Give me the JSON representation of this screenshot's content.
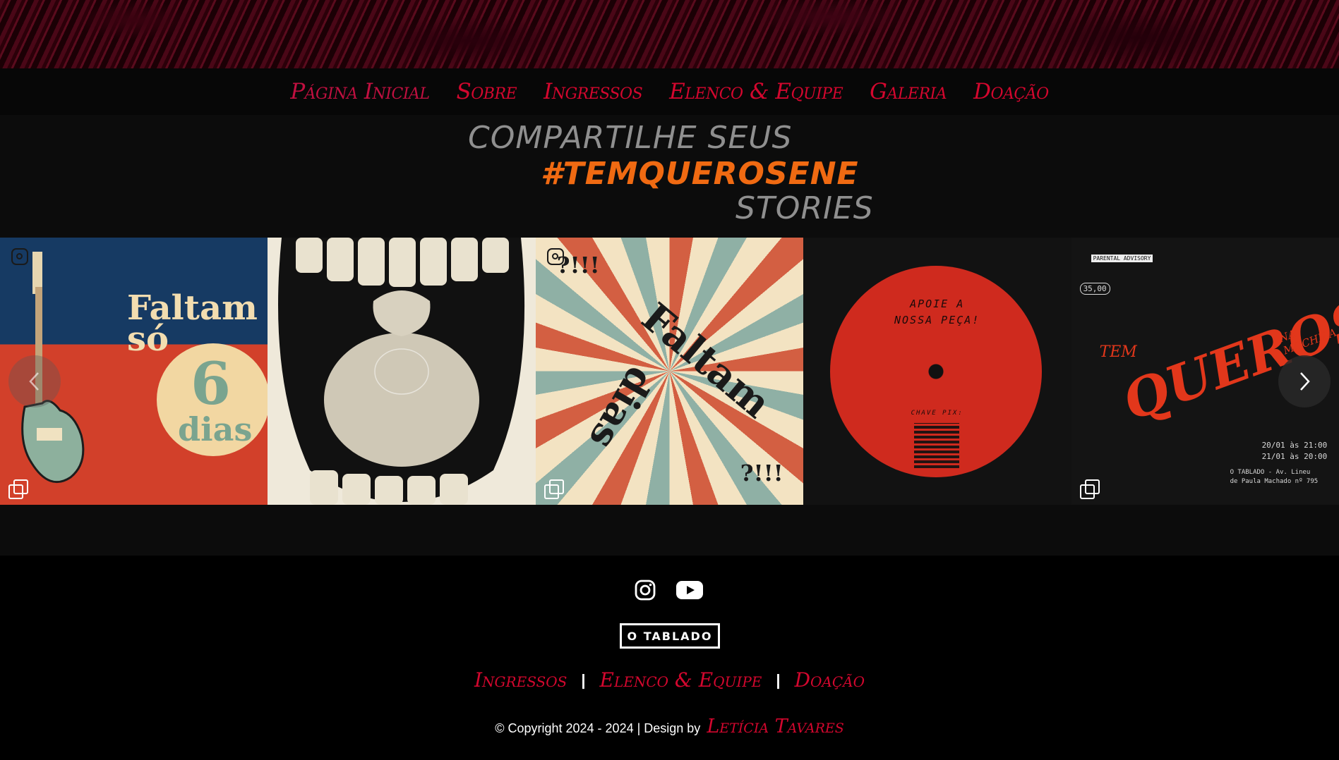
{
  "nav": {
    "items": [
      {
        "label": "Página Inicial"
      },
      {
        "label": "Sobre"
      },
      {
        "label": "Ingressos"
      },
      {
        "label": "Elenco & Equipe"
      },
      {
        "label": "Galeria"
      },
      {
        "label": "Doação"
      }
    ]
  },
  "feed": {
    "heading_line1": "COMPARTILHE SEUS",
    "heading_line2": "#TEMQUEROSENE",
    "heading_line3": "STORIES",
    "posts": [
      {
        "text_a": "Faltam",
        "text_b": "só",
        "number": "6",
        "unit": "dias"
      },
      {},
      {
        "corner_a": "?!!!",
        "word_a": "Faltam",
        "word_b": "dias",
        "corner_b": "?!!!"
      },
      {
        "line1": "APOIE A",
        "line2": "NOSSA PEÇA!",
        "key_label": "CHAVE PIX:"
      },
      {
        "title_a": "TEM",
        "title_b": "QUEROSENE",
        "title_c": "NA MOCHILA",
        "price": "35,00",
        "date1": "20/01 às 21:00",
        "date2": "21/01 às 20:00",
        "venue1": "O TABLADO - Av. Lineu",
        "venue2": "de Paula Machado nº 795",
        "advisory": "PARENTAL ADVISORY"
      }
    ]
  },
  "footer": {
    "brand": "O TABLADO",
    "links": [
      {
        "label": "Ingressos"
      },
      {
        "label": "Elenco & Equipe"
      },
      {
        "label": "Doação"
      }
    ],
    "separator": "|",
    "copyright": "© Copyright 2024 - 2024 | Design by",
    "designer": "Letícia Tavares"
  },
  "colors": {
    "accent": "#d3072e",
    "hashtag": "#f06a12",
    "muted": "#8f8f8f"
  },
  "icons": [
    "instagram-icon",
    "youtube-icon",
    "chevron-left-icon",
    "chevron-right-icon",
    "carousel-icon"
  ]
}
